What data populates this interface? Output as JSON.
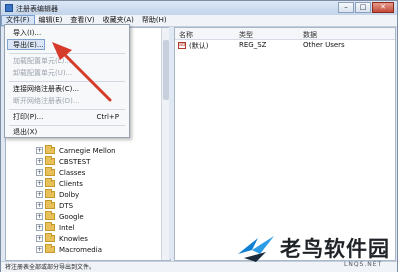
{
  "window": {
    "title": "注册表编辑器",
    "min_glyph": "–",
    "max_glyph": "□",
    "close_glyph": "✕"
  },
  "menubar": [
    {
      "label": "文件(F)"
    },
    {
      "label": "编辑(E)"
    },
    {
      "label": "查看(V)"
    },
    {
      "label": "收藏夹(A)"
    },
    {
      "label": "帮助(H)"
    }
  ],
  "file_menu": {
    "items": [
      {
        "label": "导入(I)...",
        "shortcut": "",
        "enabled": true
      },
      {
        "label": "导出(E)...",
        "shortcut": "",
        "enabled": true,
        "highlighted": true
      },
      {
        "label": "加载配置单元(L)...",
        "shortcut": "",
        "enabled": false
      },
      {
        "label": "卸载配置单元(U)...",
        "shortcut": "",
        "enabled": false
      },
      {
        "label": "连接网络注册表(C)...",
        "shortcut": "",
        "enabled": true
      },
      {
        "label": "断开网络注册表(D)...",
        "shortcut": "",
        "enabled": false
      },
      {
        "label": "打印(P)...",
        "shortcut": "Ctrl+P",
        "enabled": true
      },
      {
        "label": "退出(X)",
        "shortcut": "",
        "enabled": true
      }
    ]
  },
  "tree": {
    "items": [
      {
        "label": "Carnegie Mellon"
      },
      {
        "label": "CBSTEST"
      },
      {
        "label": "Classes"
      },
      {
        "label": "Clients"
      },
      {
        "label": "Dolby"
      },
      {
        "label": "DTS"
      },
      {
        "label": "Google"
      },
      {
        "label": "Intel"
      },
      {
        "label": "Knowles"
      },
      {
        "label": "Macromedia"
      }
    ]
  },
  "values": {
    "columns": {
      "name": "名称",
      "type": "类型",
      "data": "数据"
    },
    "rows": [
      {
        "icon": "ab",
        "name": "(默认)",
        "type": "REG_SZ",
        "data": "Other Users"
      }
    ]
  },
  "statusbar": {
    "text": "将注册表全部或部分导出到文件。"
  },
  "watermark": {
    "name": "老鸟软件园",
    "sub": "LNQS.NET"
  },
  "colors": {
    "arrow": "#d63a2a",
    "selection_border": "#7ea2cf",
    "selection_fill": "#dbe7f6"
  }
}
